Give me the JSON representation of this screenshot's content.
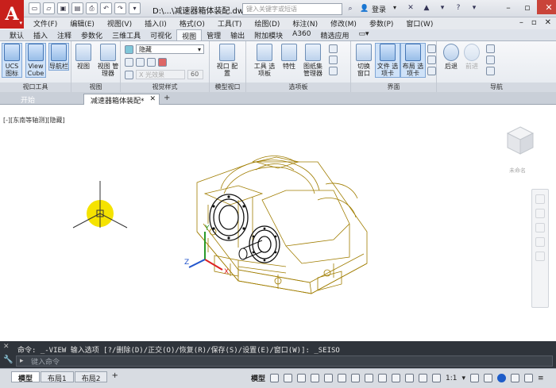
{
  "titlebar": {
    "app_logo": "A",
    "document_title": "D:\\...\\减速器箱体装配.dwg",
    "search_placeholder": "键入关键字或短语",
    "login_label": "登录"
  },
  "menu": {
    "items": [
      "文件(F)",
      "编辑(E)",
      "视图(V)",
      "插入(I)",
      "格式(O)",
      "工具(T)",
      "绘图(D)",
      "标注(N)",
      "修改(M)",
      "参数(P)",
      "窗口(W)"
    ]
  },
  "ribbon_tabs": {
    "items": [
      "默认",
      "插入",
      "注释",
      "参数化",
      "三维工具",
      "可视化",
      "视图",
      "管理",
      "输出",
      "附加模块",
      "A360",
      "精选应用"
    ],
    "active_index": 6
  },
  "ribbon": {
    "viewport_tools": {
      "title": "视口工具",
      "ucs_label": "UCS 图标",
      "viewcube_label": "View Cube",
      "navbar_label": "导航栏"
    },
    "views": {
      "title": "视图",
      "view_label": "视图",
      "view_manager_label": "视图 管理器"
    },
    "visual_styles": {
      "title": "视觉样式",
      "style_value": "隐藏",
      "opacity_value": "60",
      "field_placeholder": "X 光效果"
    },
    "model_viewports": {
      "title": "模型视口",
      "viewport_config_label": "视口 配置"
    },
    "palettes": {
      "title": "选项板",
      "tool_palettes_label": "工具 选项板",
      "properties_label": "特性",
      "sheet_set_label": "图纸集 管理器"
    },
    "interface": {
      "title": "界面",
      "switch_windows_label": "切换 窗口",
      "file_tabs_label": "文件 选项卡",
      "layout_tabs_label": "布局 选项卡"
    },
    "navigate": {
      "title": "导航",
      "back_label": "后退",
      "forward_label": "前进"
    }
  },
  "doc_tabs": {
    "start_label": "开始",
    "active_label": "减速器箱体装配*"
  },
  "canvas": {
    "view_label": "[-][东南等轴测][隐藏]",
    "viewcube_caption": "未命名"
  },
  "command": {
    "history": "命令: _-VIEW 输入选项 [?/删除(D)/正交(O)/恢复(R)/保存(S)/设置(E)/窗口(W)]: _SEISO",
    "input_placeholder": "键入命令"
  },
  "status": {
    "layout_tabs": [
      "模型",
      "布局1",
      "布局2"
    ],
    "model_label": "模型",
    "scale_label": "1:1"
  },
  "colors": {
    "app_red": "#c8201c",
    "model_lines": "#a07d00",
    "light_glyph": "#f5e300"
  }
}
